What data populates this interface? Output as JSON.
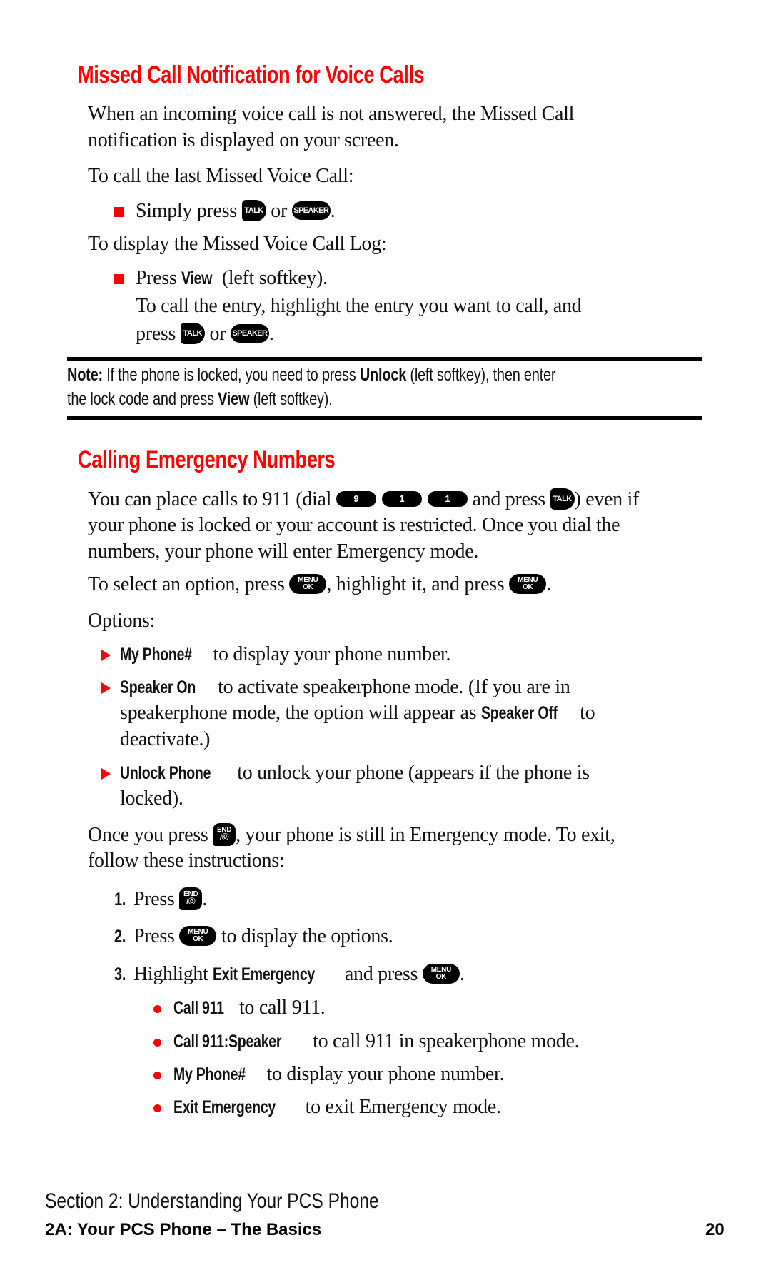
{
  "section1": {
    "title": "Missed Call Notification for Voice Calls",
    "intro_line1": "When an incoming voice call is not answered, the Missed Call",
    "intro_line2": "notification is displayed on your screen.",
    "call_last_label": "To call the last Missed Voice Call:",
    "simply_press": "Simply press",
    "or": "or",
    "period": ".",
    "display_log_label": "To display the Missed Voice Call Log:",
    "press": "Press",
    "view": "View",
    "left_softkey": "(left softkey).",
    "call_entry_line1": "To call the entry, highlight the entry you want to call, and",
    "call_entry_press": "press"
  },
  "keys": {
    "talk": "TALK",
    "speaker": "SPEAKER",
    "nine": "9",
    "one": "1",
    "menu_top": "MENU",
    "menu_bottom": "OK",
    "end_top": "END",
    "end_bottom": "/⓪"
  },
  "note": {
    "label": "Note:",
    "text1": "If the phone is locked, you need to press",
    "unlock": "Unlock",
    "text2": "(left softkey), then enter",
    "text3": "the lock code and press",
    "view": "View",
    "text4": "(left softkey)."
  },
  "section2": {
    "title": "Calling Emergency Numbers",
    "p1_a": "You can place calls to 911 (dial",
    "p1_b": "and press",
    "p1_c": ") even if",
    "p1_line2": "your phone is locked or your account is restricted. Once you dial the",
    "p1_line3": "numbers, your phone will enter Emergency mode.",
    "select_a": "To select an option, press",
    "select_b": ", highlight it, and press",
    "select_c": ".",
    "options_label": "Options:",
    "options": [
      {
        "bold": "My Phone#",
        "text": "to display your phone number."
      },
      {
        "bold": "Speaker On",
        "text": "to activate speakerphone mode. (If you are in",
        "line2_a": "speakerphone mode, the option will appear as",
        "line2_bold": "Speaker Off",
        "line2_b": "to",
        "line3": "deactivate.)"
      },
      {
        "bold": "Unlock Phone",
        "text": "to unlock your phone (appears if the phone is",
        "line2": "locked)."
      }
    ],
    "once_a": "Once you press",
    "once_b": ", your phone is still in Emergency mode. To exit,",
    "once_line2": "follow these instructions:",
    "steps": [
      {
        "num": "1.",
        "a": "Press",
        "b": "."
      },
      {
        "num": "2.",
        "a": "Press",
        "b": "to display the options."
      },
      {
        "num": "3.",
        "a": "Highlight",
        "bold": "Exit Emergency",
        "b": "and press",
        "c": "."
      }
    ],
    "sub_options": [
      {
        "bold": "Call 911",
        "text": "to call 911."
      },
      {
        "bold": "Call 911:Speaker",
        "text": "to call 911 in speakerphone mode."
      },
      {
        "bold": "My Phone#",
        "text": "to display your phone number."
      },
      {
        "bold": "Exit Emergency",
        "text": "to exit Emergency mode."
      }
    ]
  },
  "footer": {
    "section": "Section 2: Understanding Your PCS Phone",
    "chapter": "2A: Your PCS Phone – The Basics",
    "page_number": "20"
  },
  "colors": {
    "accent": "#ff0000",
    "text": "#111111",
    "rule": "#000000"
  }
}
